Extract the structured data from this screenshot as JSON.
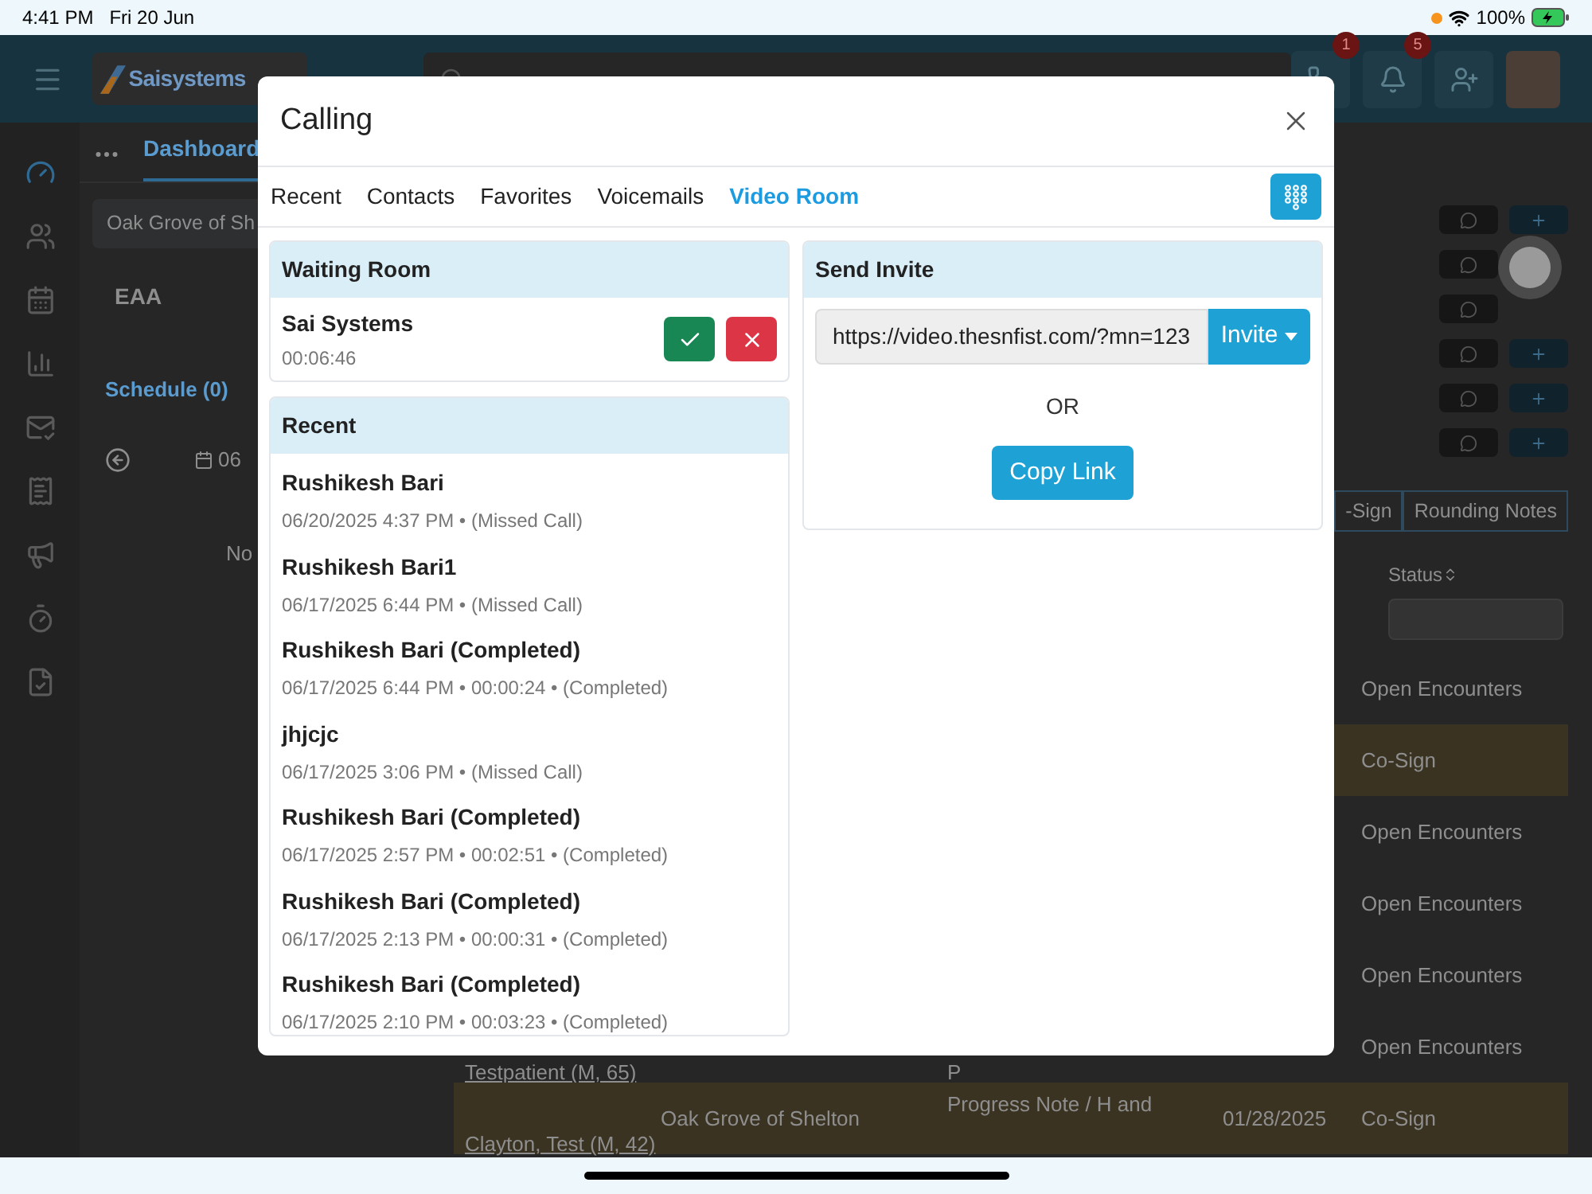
{
  "status_bar": {
    "time": "4:41 PM",
    "date": "Fri 20 Jun",
    "battery": "100%"
  },
  "header": {
    "logo": "Saisystems",
    "buttons": [
      {
        "kind": "phone",
        "badge": "1"
      },
      {
        "kind": "bell",
        "badge": "5"
      },
      {
        "kind": "user-plus"
      }
    ]
  },
  "left_panel": {
    "tab": "Dashboard",
    "facility": "Oak Grove of Sh",
    "organization": "EAA",
    "schedule": "Schedule (0)",
    "date": "06",
    "empty_text": "No"
  },
  "right_panel": {
    "segments": [
      "-Sign",
      "Rounding Notes"
    ],
    "status_header": "Status",
    "rows": [
      {
        "status": "Open Encounters",
        "highlighted": false
      },
      {
        "status": "Co-Sign",
        "highlighted": true
      },
      {
        "status": "Open Encounters",
        "highlighted": false
      },
      {
        "status": "Open Encounters",
        "highlighted": false
      },
      {
        "status": "Open Encounters",
        "highlighted": false
      },
      {
        "name": "Testpatient (M, 65)",
        "type": "P",
        "status": "Open Encounters",
        "highlighted": false
      },
      {
        "name": "Clayton, Test (M, 42)",
        "facility": "Oak Grove of Shelton",
        "type": "Progress Note / H and",
        "date": "01/28/2025",
        "status": "Co-Sign",
        "highlighted": true
      }
    ]
  },
  "dialog": {
    "title": "Calling",
    "tabs": [
      {
        "label": "Recent",
        "selected": false
      },
      {
        "label": "Contacts",
        "selected": false
      },
      {
        "label": "Favorites",
        "selected": false
      },
      {
        "label": "Voicemails",
        "selected": false
      },
      {
        "label": "Video Room",
        "selected": true
      }
    ],
    "waiting_room": {
      "title": "Waiting Room",
      "entries": [
        {
          "name": "Sai Systems",
          "time": "00:06:46"
        }
      ]
    },
    "recent": {
      "title": "Recent",
      "calls": [
        {
          "name": "Rushikesh Bari",
          "detail": "06/20/2025 4:37 PM • (Missed Call)"
        },
        {
          "name": "Rushikesh Bari1",
          "detail": "06/17/2025 6:44 PM • (Missed Call)"
        },
        {
          "name": "Rushikesh Bari (Completed)",
          "detail": "06/17/2025 6:44 PM • 00:00:24 • (Completed)"
        },
        {
          "name": "jhjcjc",
          "detail": "06/17/2025 3:06 PM • (Missed Call)"
        },
        {
          "name": "Rushikesh Bari (Completed)",
          "detail": "06/17/2025 2:57 PM • 00:02:51 • (Completed)"
        },
        {
          "name": "Rushikesh Bari (Completed)",
          "detail": "06/17/2025 2:13 PM • 00:00:31 • (Completed)"
        },
        {
          "name": "Rushikesh Bari (Completed)",
          "detail": "06/17/2025 2:10 PM • 00:03:23 • (Completed)"
        }
      ]
    },
    "send_invite": {
      "title": "Send Invite",
      "link": "https://video.thesnfist.com/?mn=123",
      "invite_button": "Invite",
      "separator": "OR",
      "copy_button": "Copy Link"
    }
  }
}
